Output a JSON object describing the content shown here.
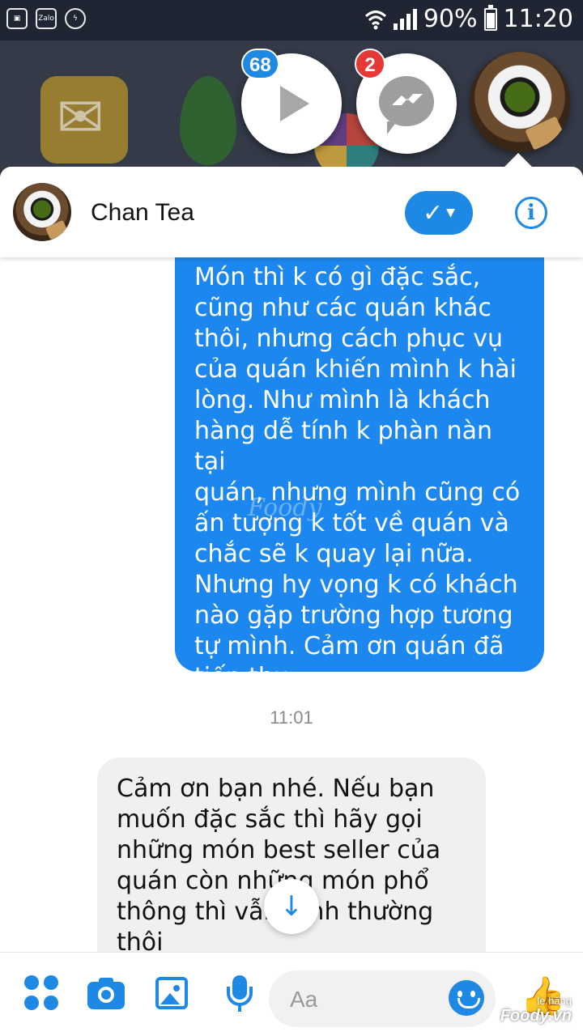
{
  "status_bar": {
    "battery": "90%",
    "time": "11:20",
    "notif_icons": [
      "image-icon",
      "zalo-icon",
      "messenger-icon"
    ],
    "zalo_label": "Zalo"
  },
  "chat_heads": {
    "video_badge": "68",
    "messenger_badge": "2"
  },
  "header": {
    "contact_name": "Chan Tea",
    "check_icon": "✓",
    "info_icon": "i"
  },
  "messages": {
    "outgoing": "Món thì k có gì đặc sắc,\ncũng như các quán khác\nthôi, nhưng cách phục vụ\ncủa quán khiến mình k hài\nlòng. Như mình là khách\nhàng dễ tính k phàn nàn tại\nquán, nhưng mình cũng có\nấn tượng k tốt về quán và\nchắc sẽ k quay lại nữa.\nNhưng hy vọng k có khách\nnào gặp trường hợp tương\ntự mình. Cảm ơn quán đã\ntiếp thu",
    "timestamp": "11:01",
    "incoming": "Cảm ơn bạn nhé. Nếu bạn\nmuốn đặc sắc thì hãy gọi\nnhững món best seller của\nquán còn những món phổ\nthông thì vẫn bình thường thôi\nạ."
  },
  "composer": {
    "placeholder": "Aa",
    "like_icon": "👍"
  },
  "watermark": {
    "small": "le hăng",
    "brand": "Foody.vn",
    "center": "Foody"
  },
  "colors": {
    "accent": "#1e88e5",
    "outgoing_bubble": "#1b87ef",
    "incoming_bubble": "#f0f0f0",
    "badge_red": "#e53935"
  }
}
